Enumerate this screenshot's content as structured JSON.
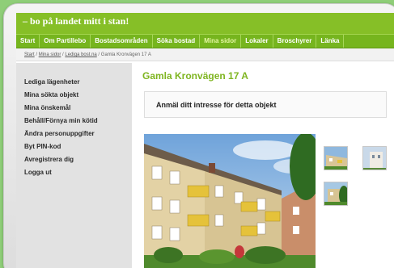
{
  "header": {
    "tagline": "– bo på landet mitt i stan!"
  },
  "nav": {
    "items": [
      {
        "label": "Start",
        "active": false
      },
      {
        "label": "Om Partillebo",
        "active": false
      },
      {
        "label": "Bostadsområden",
        "active": false
      },
      {
        "label": "Söka bostad",
        "active": false
      },
      {
        "label": "Mina sidor",
        "active": true
      },
      {
        "label": "Lokaler",
        "active": false
      },
      {
        "label": "Broschyrer",
        "active": false
      },
      {
        "label": "Länka",
        "active": false
      }
    ]
  },
  "breadcrumb": {
    "start": "Start",
    "sep1": " / ",
    "mina_sidor": "Mina sidor",
    "sep2": " / ",
    "lediga": "Lediga bost.na",
    "sep3": " / ",
    "current": "Gamla Kronvägen 17 A"
  },
  "sidebar": {
    "items": [
      {
        "label": "Lediga lägenheter"
      },
      {
        "label": "Mina sökta objekt"
      },
      {
        "label": "Mina önskemål"
      },
      {
        "label": "Behåll/Förnya min kötid"
      },
      {
        "label": "Ändra personuppgifter"
      },
      {
        "label": "Byt PIN-kod"
      },
      {
        "label": "Avregistrera dig"
      },
      {
        "label": "Logga ut"
      }
    ]
  },
  "main": {
    "title": "Gamla Kronvägen 17 A",
    "interest_label": "Anmäl ditt intresse för detta objekt"
  },
  "colors": {
    "brand_green": "#76b51e",
    "title_green": "#7fb521",
    "background": "#8fce78"
  }
}
